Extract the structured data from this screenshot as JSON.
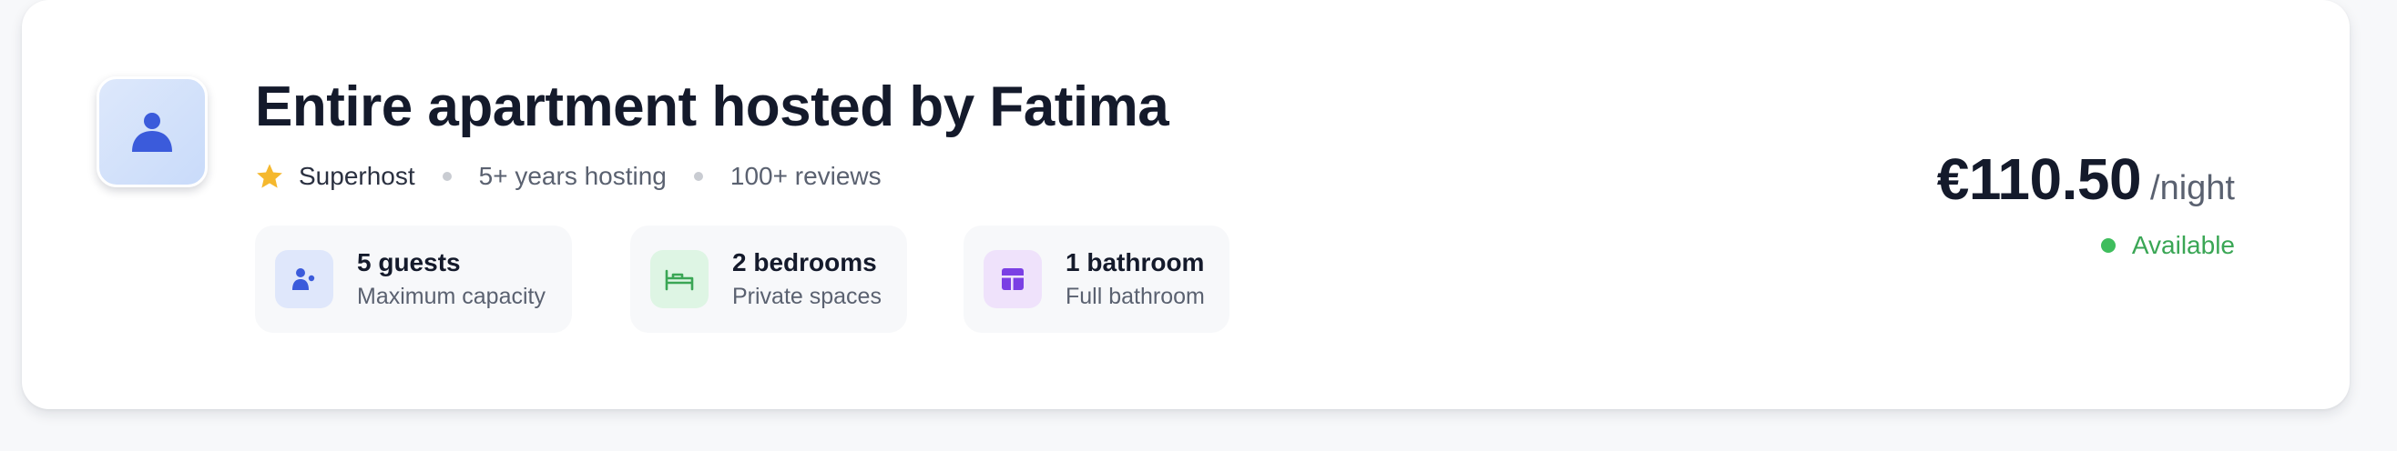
{
  "listing": {
    "title": "Entire apartment hosted by Fatima",
    "host_icon": "user-icon",
    "badges": {
      "superhost": "Superhost",
      "hosting_years": "5+ years hosting",
      "reviews": "100+ reviews"
    }
  },
  "features": [
    {
      "label": "5 guests",
      "sub": "Maximum capacity",
      "icon": "guests-icon",
      "color": "#3b5bdb",
      "bg": "#dfe7fb"
    },
    {
      "label": "2 bedrooms",
      "sub": "Private spaces",
      "icon": "bed-icon",
      "color": "#3aa655",
      "bg": "#def5e4"
    },
    {
      "label": "1 bathroom",
      "sub": "Full bathroom",
      "icon": "bathroom-icon",
      "color": "#7b3fe4",
      "bg": "#efe2fb"
    }
  ],
  "pricing": {
    "amount": "€110.50",
    "unit": "/night",
    "status": "Available",
    "status_color": "#3aa655"
  },
  "colors": {
    "accent": "#3b5bdb",
    "star": "#f5b82e",
    "title": "#141a2b",
    "muted": "#5a6170"
  }
}
